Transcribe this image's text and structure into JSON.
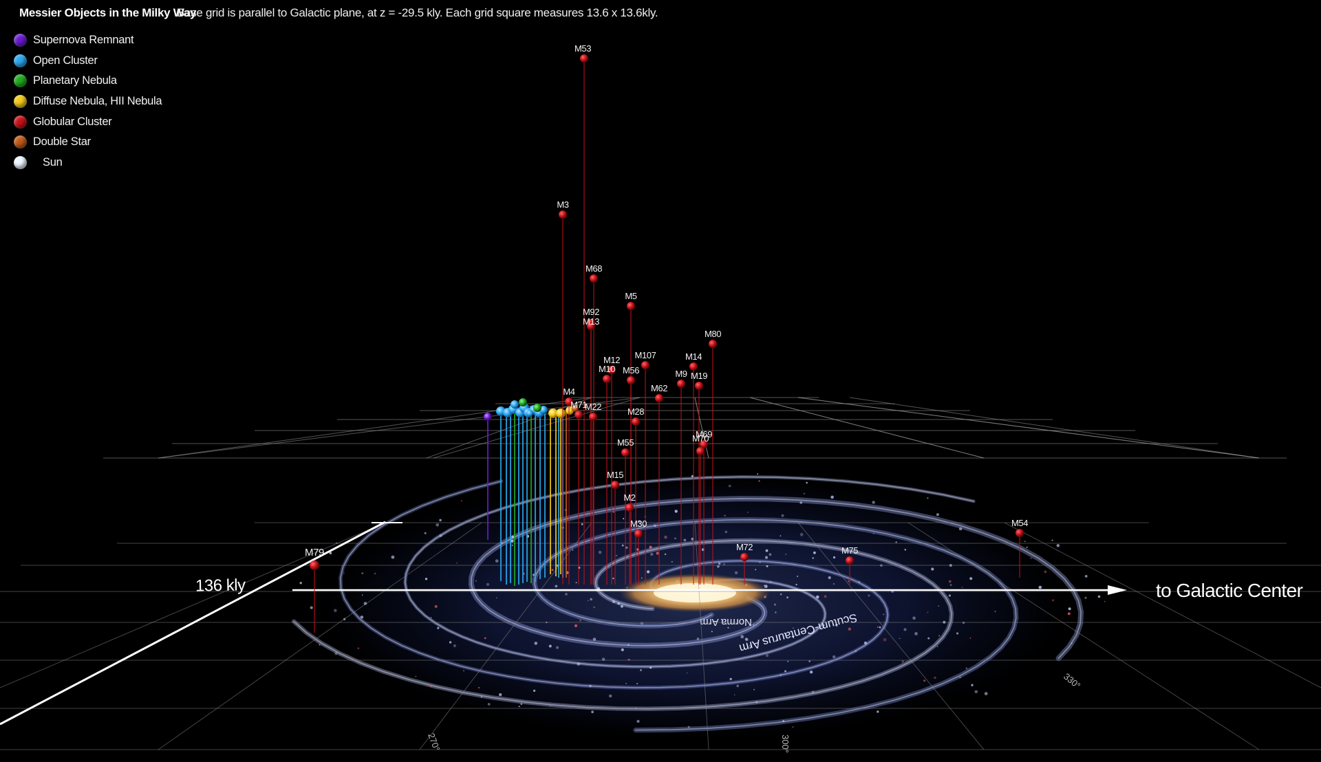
{
  "header": {
    "title": "Messier Objects in the Milky Way",
    "subtitle": "Base grid is parallel to Galactic plane, at z = -29.5 kly. Each grid square measures 13.6 x 13.6kly."
  },
  "legend": [
    {
      "label": "Supernova Remnant",
      "color": "#6a1bd0"
    },
    {
      "label": "Open Cluster",
      "color": "#2aa7f0"
    },
    {
      "label": "Planetary Nebula",
      "color": "#1faa1f"
    },
    {
      "label": "Diffuse Nebula, HII Nebula",
      "color": "#f2c81a"
    },
    {
      "label": "Globular Cluster",
      "color": "#c8121a"
    },
    {
      "label": "Double Star",
      "color": "#c05a1a"
    },
    {
      "label": "Sun",
      "color": "#eef6ff"
    }
  ],
  "axes": {
    "scale_label": "136 kly",
    "direction_label": "to Galactic Center"
  },
  "galaxy_labels": {
    "arm_outer": "Scutum-Centaurus Arm",
    "arm_inner": "Norma Arm",
    "deg_270": "270°",
    "deg_300": "300°",
    "deg_330": "330°"
  },
  "objects": [
    {
      "name": "M53",
      "type": "Globular Cluster"
    },
    {
      "name": "M3",
      "type": "Globular Cluster"
    },
    {
      "name": "M68",
      "type": "Globular Cluster"
    },
    {
      "name": "M5",
      "type": "Globular Cluster"
    },
    {
      "name": "M92",
      "type": "Globular Cluster"
    },
    {
      "name": "M13",
      "type": "Globular Cluster"
    },
    {
      "name": "M80",
      "type": "Globular Cluster"
    },
    {
      "name": "M107",
      "type": "Globular Cluster"
    },
    {
      "name": "M12",
      "type": "Globular Cluster"
    },
    {
      "name": "M14",
      "type": "Globular Cluster"
    },
    {
      "name": "M10",
      "type": "Globular Cluster"
    },
    {
      "name": "M56",
      "type": "Globular Cluster"
    },
    {
      "name": "M9",
      "type": "Globular Cluster"
    },
    {
      "name": "M19",
      "type": "Globular Cluster"
    },
    {
      "name": "M62",
      "type": "Globular Cluster"
    },
    {
      "name": "M4",
      "type": "Globular Cluster"
    },
    {
      "name": "M71",
      "type": "Globular Cluster"
    },
    {
      "name": "M22",
      "type": "Globular Cluster"
    },
    {
      "name": "M28",
      "type": "Globular Cluster"
    },
    {
      "name": "M55",
      "type": "Globular Cluster"
    },
    {
      "name": "M69",
      "type": "Globular Cluster"
    },
    {
      "name": "M70",
      "type": "Globular Cluster"
    },
    {
      "name": "M15",
      "type": "Globular Cluster"
    },
    {
      "name": "M2",
      "type": "Globular Cluster"
    },
    {
      "name": "M30",
      "type": "Globular Cluster"
    },
    {
      "name": "M54",
      "type": "Globular Cluster"
    },
    {
      "name": "M72",
      "type": "Globular Cluster"
    },
    {
      "name": "M75",
      "type": "Globular Cluster"
    },
    {
      "name": "M79",
      "type": "Globular Cluster"
    }
  ]
}
